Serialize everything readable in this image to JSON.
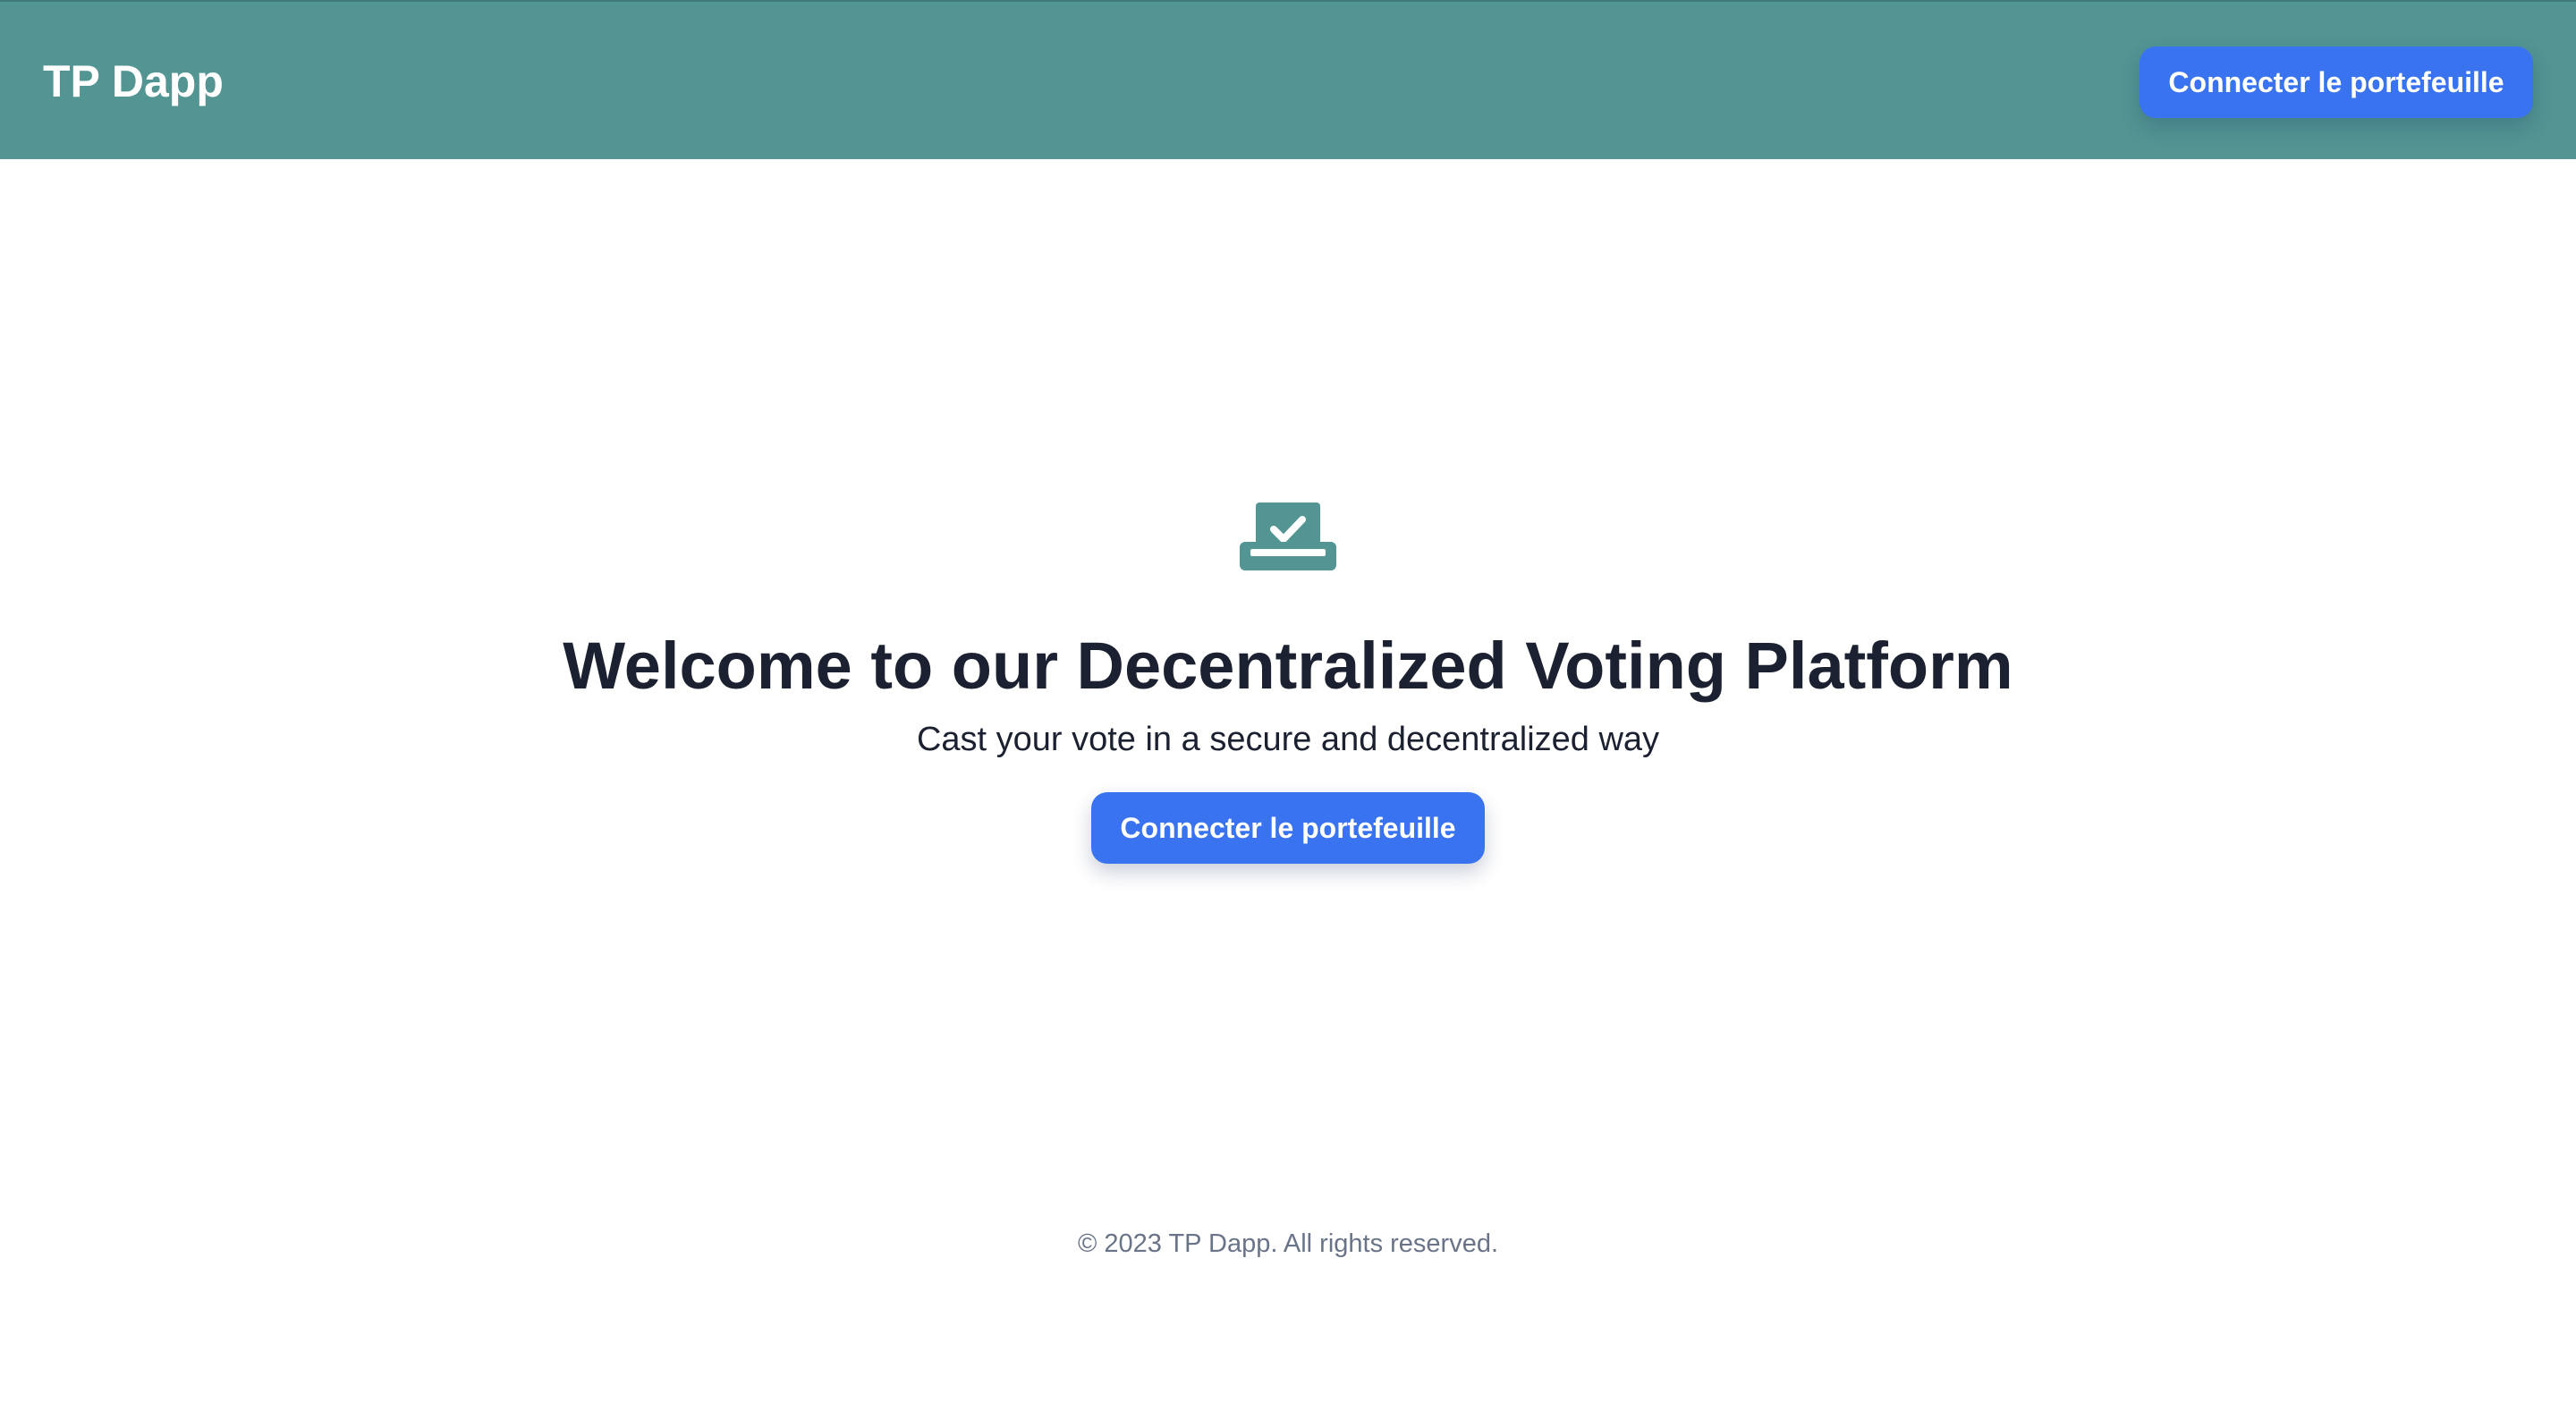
{
  "header": {
    "brand": "TP Dapp",
    "connect_label": "Connecter le portefeuille"
  },
  "hero": {
    "icon": "ballot-box-check-icon",
    "title": "Welcome to our Decentralized Voting Platform",
    "subtitle": "Cast your vote in a secure and decentralized way",
    "connect_label": "Connecter le portefeuille"
  },
  "footer": {
    "copyright": "© 2023 TP Dapp. All rights reserved."
  },
  "colors": {
    "header_bg": "#529593",
    "accent": "#3a73ef",
    "icon": "#529593",
    "text": "#1b2130",
    "muted": "#6a7488"
  }
}
